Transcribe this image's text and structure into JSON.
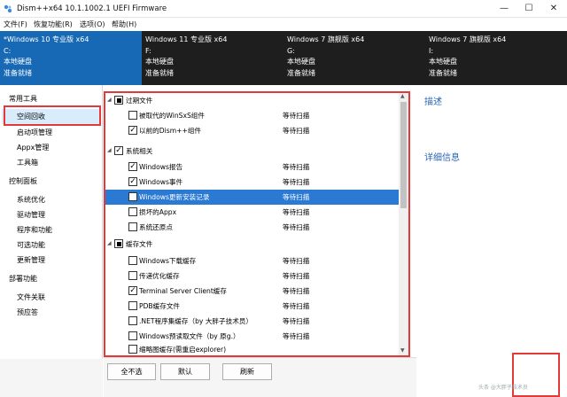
{
  "window": {
    "title": "Dism++x64 10.1.1002.1 UEFI Firmware",
    "controls": {
      "minimize": "—",
      "maximize": "☐",
      "close": "✕"
    }
  },
  "menu": [
    "文件(F)",
    "恢复功能(R)",
    "选项(O)",
    "帮助(H)"
  ],
  "systems": [
    {
      "name": "*Windows 10 专业版 x64",
      "drive": "C:",
      "disk": "本地硬盘",
      "status": "准备就绪",
      "active": true
    },
    {
      "name": "Windows 11 专业版 x64",
      "drive": "F:",
      "disk": "本地硬盘",
      "status": "准备就绪",
      "active": false
    },
    {
      "name": "Windows 7 旗舰版 x64",
      "drive": "G:",
      "disk": "本地硬盘",
      "status": "准备就绪",
      "active": false
    },
    {
      "name": "Windows 7 旗舰版 x64",
      "drive": "I:",
      "disk": "本地硬盘",
      "status": "准备就绪",
      "active": false
    }
  ],
  "sidebar": {
    "items": [
      {
        "label": "常用工具",
        "kind": "group"
      },
      {
        "label": "空间回收",
        "kind": "sub",
        "selected": true
      },
      {
        "label": "启动项管理",
        "kind": "sub"
      },
      {
        "label": "Appx管理",
        "kind": "sub"
      },
      {
        "label": "工具箱",
        "kind": "sub"
      },
      {
        "label": "控制面板",
        "kind": "group"
      },
      {
        "label": "系统优化",
        "kind": "sub"
      },
      {
        "label": "驱动管理",
        "kind": "sub"
      },
      {
        "label": "程序和功能",
        "kind": "sub"
      },
      {
        "label": "可选功能",
        "kind": "sub"
      },
      {
        "label": "更新管理",
        "kind": "sub"
      },
      {
        "label": "部署功能",
        "kind": "group"
      },
      {
        "label": "文件关联",
        "kind": "sub"
      },
      {
        "label": "预应答",
        "kind": "sub"
      }
    ]
  },
  "list": {
    "rows": [
      {
        "type": "group",
        "label": "过期文件",
        "check": "partial"
      },
      {
        "type": "item",
        "label": "被取代的WinSxS组件",
        "state": "等待扫描",
        "check": "off"
      },
      {
        "type": "item",
        "label": "以前的Dism++组件",
        "state": "等待扫描",
        "check": "on"
      },
      {
        "type": "group",
        "label": "系统相关",
        "check": "on"
      },
      {
        "type": "item",
        "label": "Windows报告",
        "state": "等待扫描",
        "check": "on"
      },
      {
        "type": "item",
        "label": "Windows事件",
        "state": "等待扫描",
        "check": "on"
      },
      {
        "type": "item",
        "label": "Windows更新安装记录",
        "state": "等待扫描",
        "check": "off",
        "highlight": true
      },
      {
        "type": "item",
        "label": "损坏的Appx",
        "state": "等待扫描",
        "check": "off"
      },
      {
        "type": "item",
        "label": "系统还原点",
        "state": "等待扫描",
        "check": "off"
      },
      {
        "type": "group",
        "label": "缓存文件",
        "check": "partial"
      },
      {
        "type": "item",
        "label": "Windows下载缓存",
        "state": "等待扫描",
        "check": "off"
      },
      {
        "type": "item",
        "label": "传递优化缓存",
        "state": "等待扫描",
        "check": "off"
      },
      {
        "type": "item",
        "label": "Terminal Server Client缓存",
        "state": "等待扫描",
        "check": "on"
      },
      {
        "type": "item",
        "label": "PDB缓存文件",
        "state": "等待扫描",
        "check": "off"
      },
      {
        "type": "item",
        "label": ".NET程序集缓存（by 大胖子技术员）",
        "state": "等待扫描",
        "check": "off"
      },
      {
        "type": "item",
        "label": "Windows预读取文件（by 原g.）",
        "state": "等待扫描",
        "check": "off"
      },
      {
        "type": "item",
        "label": "缩略图缓存(需重启explorer)",
        "state": "等待扫描",
        "check": "off"
      }
    ]
  },
  "details": {
    "describe": "描述",
    "info": "详细信息"
  },
  "buttons": {
    "select_none": "全不选",
    "default": "默认",
    "refresh": "刷新"
  },
  "watermark": "头条 @大胖子技术员"
}
